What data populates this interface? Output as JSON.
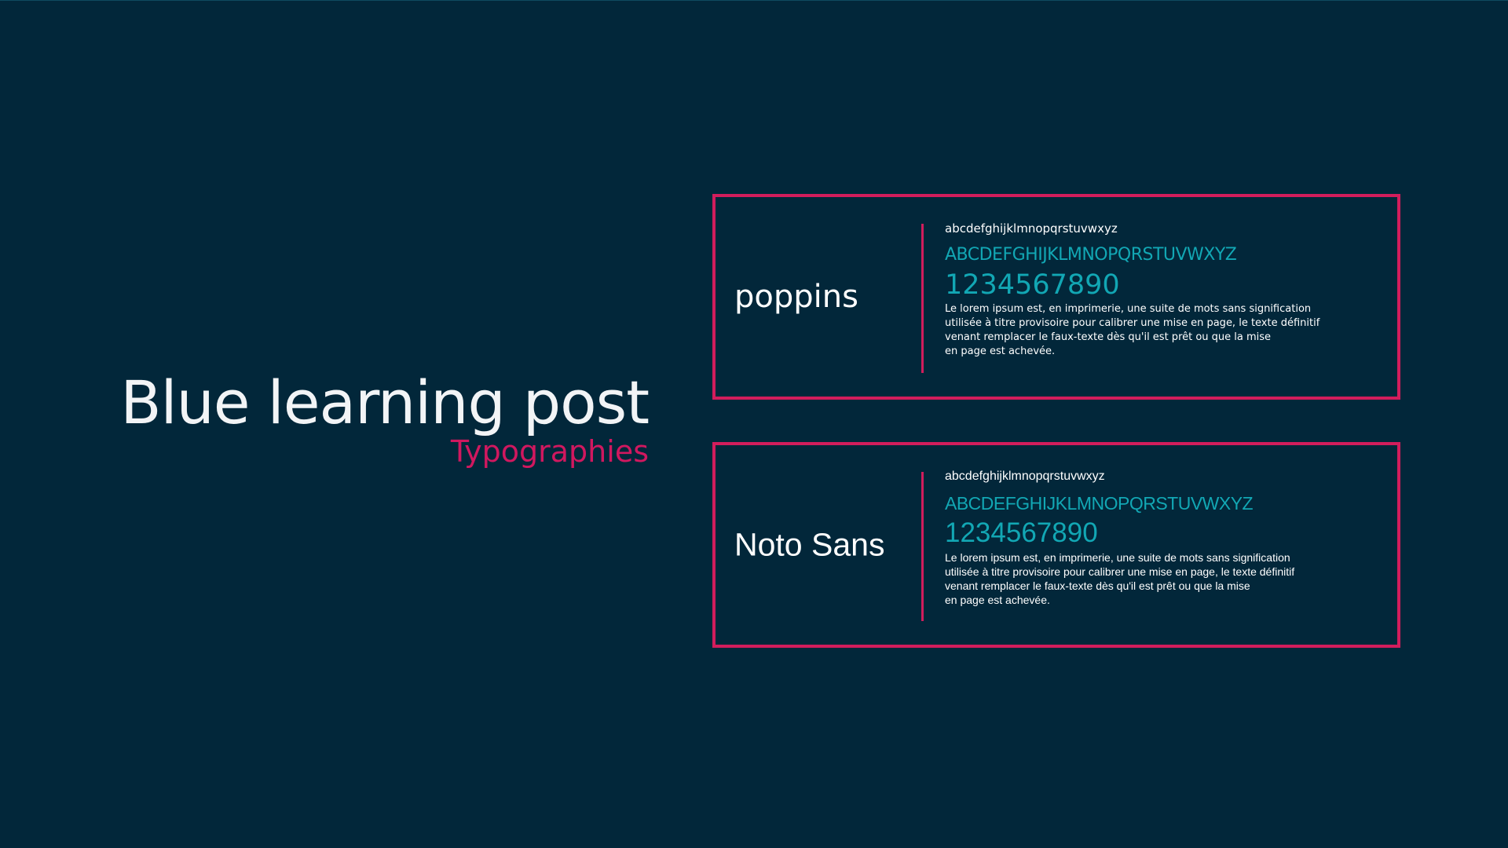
{
  "title": "Blue learning post",
  "subtitle": "Typographies",
  "fonts": [
    {
      "name": "poppins",
      "lowercase": "abcdefghijklmnopqrstuvwxyz",
      "uppercase": "ABCDEFGHIJKLMNOPQRSTUVWXYZ",
      "digits": "1234567890",
      "sample_lines": [
        "Le lorem ipsum est, en imprimerie, une suite de mots sans signification",
        "utilisée à titre provisoire pour calibrer une mise en page, le texte définitif",
        "venant remplacer le faux-texte dès qu'il est prêt ou que la mise",
        "en page est achevée."
      ]
    },
    {
      "name": "Noto Sans",
      "lowercase": "abcdefghijklmnopqrstuvwxyz",
      "uppercase": "ABCDEFGHIJKLMNOPQRSTUVWXYZ",
      "digits": "1234567890",
      "sample_lines": [
        "Le lorem ipsum est, en imprimerie, une suite de mots sans signification",
        "utilisée à titre provisoire pour calibrer une mise en page, le texte définitif",
        "venant remplacer le faux-texte dès qu'il est prêt ou que la mise",
        "en page est achevée."
      ]
    }
  ],
  "colors": {
    "background": "#02273a",
    "accent": "#d21d5c",
    "teal": "#12a7b4",
    "text": "#ffffff"
  }
}
